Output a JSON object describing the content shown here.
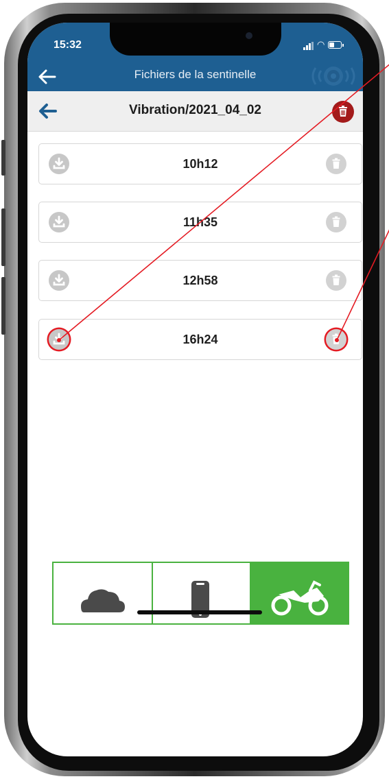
{
  "status_bar": {
    "time": "15:32"
  },
  "header": {
    "title": "Fichiers de la sentinelle"
  },
  "path_bar": {
    "title": "Vibration/2021_04_02"
  },
  "files": [
    {
      "label": "10h12",
      "highlighted": false
    },
    {
      "label": "11h35",
      "highlighted": false
    },
    {
      "label": "12h58",
      "highlighted": false
    },
    {
      "label": "16h24",
      "highlighted": true
    }
  ],
  "bottom_tabs": [
    {
      "icon": "cloud-icon",
      "active": false
    },
    {
      "icon": "phone-icon",
      "active": false
    },
    {
      "icon": "motorcycle-icon",
      "active": true
    }
  ],
  "colors": {
    "header_blue": "#1e5f92",
    "active_green": "#49b23f",
    "delete_red": "#a31b1b",
    "annotation_red": "#e41b23"
  }
}
